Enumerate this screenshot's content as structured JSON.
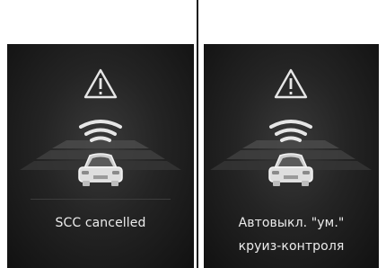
{
  "panels": [
    {
      "lines": [
        "SCC cancelled"
      ]
    },
    {
      "lines": [
        "Автовыкл. \"ум.\"",
        "круиз-контроля"
      ]
    }
  ],
  "icons": {
    "warning": "warning-triangle-icon",
    "radar": "radar-waves-icon",
    "car": "car-rear-icon"
  },
  "colors": {
    "panel_background": "#1c1c1c",
    "text": "#ececec",
    "icon_stroke": "#e6e6e6",
    "radar_band": "#4a4a4a"
  }
}
